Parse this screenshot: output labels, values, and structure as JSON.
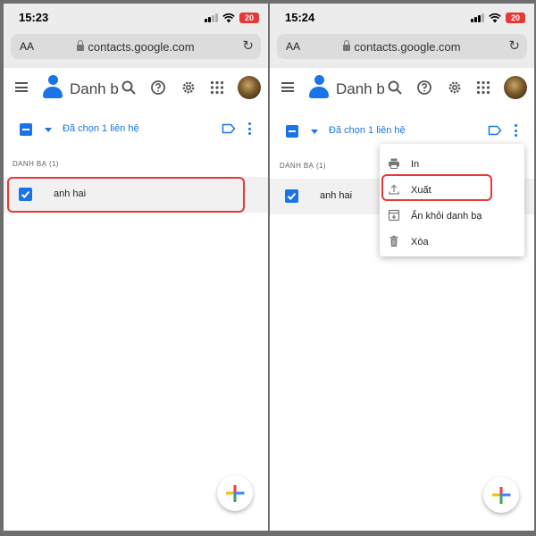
{
  "colors": {
    "accent": "#1a73e8",
    "highlight": "#e53935",
    "battery": "#e53935"
  },
  "screens": [
    {
      "status": {
        "time": "15:23",
        "battery": "20"
      },
      "browser": {
        "aa": "AA",
        "url": "contacts.google.com"
      },
      "header": {
        "title": "Danh b"
      },
      "toolbar": {
        "selected_text": "Đã chọn 1 liên hệ"
      },
      "section_label": "DANH BẠ (1)",
      "contact": {
        "name": "anh hai",
        "checked": true
      }
    },
    {
      "status": {
        "time": "15:24",
        "battery": "20"
      },
      "browser": {
        "aa": "AA",
        "url": "contacts.google.com"
      },
      "header": {
        "title": "Danh b"
      },
      "toolbar": {
        "selected_text": "Đã chọn 1 liên hệ"
      },
      "section_label": "DANH BẠ (1)",
      "contact": {
        "name": "anh hai",
        "checked": true
      },
      "menu": {
        "items": [
          {
            "label": "In",
            "icon": "print-icon"
          },
          {
            "label": "Xuất",
            "icon": "export-icon"
          },
          {
            "label": "Ẩn khỏi danh bạ",
            "icon": "hide-contact-icon"
          },
          {
            "label": "Xóa",
            "icon": "trash-icon"
          }
        ]
      }
    }
  ]
}
